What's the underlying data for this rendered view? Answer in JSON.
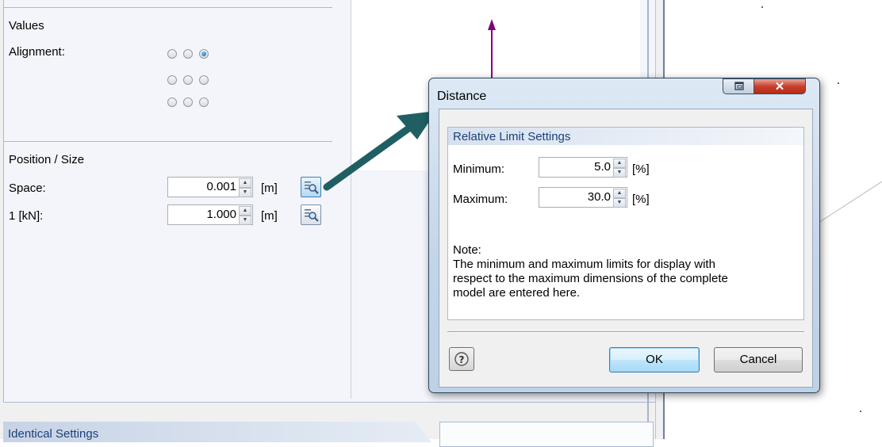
{
  "values_section": {
    "heading": "Values",
    "alignment_label": "Alignment:",
    "alignment_selected": "top-right"
  },
  "position_section": {
    "heading": "Position / Size",
    "space": {
      "label": "Space:",
      "value": "0.001",
      "unit": "[m]"
    },
    "kn": {
      "label": "1  [kN]:",
      "value": "1.000",
      "unit": "[m]"
    }
  },
  "identical_settings": {
    "label": "Identical Settings"
  },
  "dialog": {
    "title": "Distance",
    "group_title": "Relative Limit Settings",
    "minimum": {
      "label": "Minimum:",
      "value": "5.0",
      "unit": "[%]"
    },
    "maximum": {
      "label": "Maximum:",
      "value": "30.0",
      "unit": "[%]"
    },
    "note_heading": "Note:",
    "note_lines": [
      "The minimum and maximum limits for display with",
      "respect to the maximum dimensions of the complete",
      "model are entered here."
    ],
    "ok_label": "OK",
    "cancel_label": "Cancel"
  },
  "colors": {
    "callout_arrow": "#1f5f63",
    "axis_arrow": "#800080",
    "section_text": "#1b3f7a"
  }
}
